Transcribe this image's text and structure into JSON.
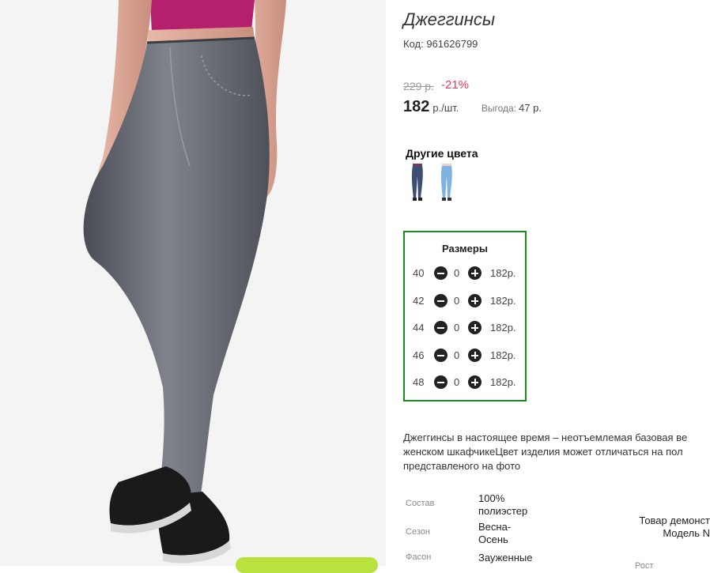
{
  "product": {
    "title": "Джеггинсы",
    "code_label": "Код:",
    "code_value": "961626799",
    "old_price": "229 р.",
    "discount": "-21%",
    "price": "182",
    "unit": "р./шт.",
    "benefit_label": "Выгода:",
    "benefit_value": "47 р."
  },
  "colors": {
    "title": "Другие цвета",
    "items": [
      {
        "name": "dark-denim",
        "color": "#3c4f73"
      },
      {
        "name": "light-denim",
        "color": "#7fb4e0"
      }
    ]
  },
  "sizes": {
    "title": "Размеры",
    "rows": [
      {
        "size": "40",
        "qty": "0",
        "price": "182р."
      },
      {
        "size": "42",
        "qty": "0",
        "price": "182р."
      },
      {
        "size": "44",
        "qty": "0",
        "price": "182р."
      },
      {
        "size": "46",
        "qty": "0",
        "price": "182р."
      },
      {
        "size": "48",
        "qty": "0",
        "price": "182р."
      }
    ]
  },
  "description": {
    "line1": "Джеггинсы в настоящее время – неотъемлемая базовая ве",
    "line2": "женском шкафчикеЦвет изделия может отличаться на пол",
    "line3": "представленого на фото"
  },
  "specs": [
    {
      "label": "Состав",
      "value": "100% полиэстер"
    },
    {
      "label": "Сезон",
      "value": "Весна-Осень"
    },
    {
      "label": "Фасон",
      "value": "Зауженные"
    }
  ],
  "demo_note": {
    "line1": "Товар демонст",
    "line2": "Модель N",
    "rost_label": "Рост"
  },
  "accent_colors": {
    "discount": "#e8385a",
    "sizes_border": "#1a8a1a",
    "cart_button": "#b9e23f"
  }
}
